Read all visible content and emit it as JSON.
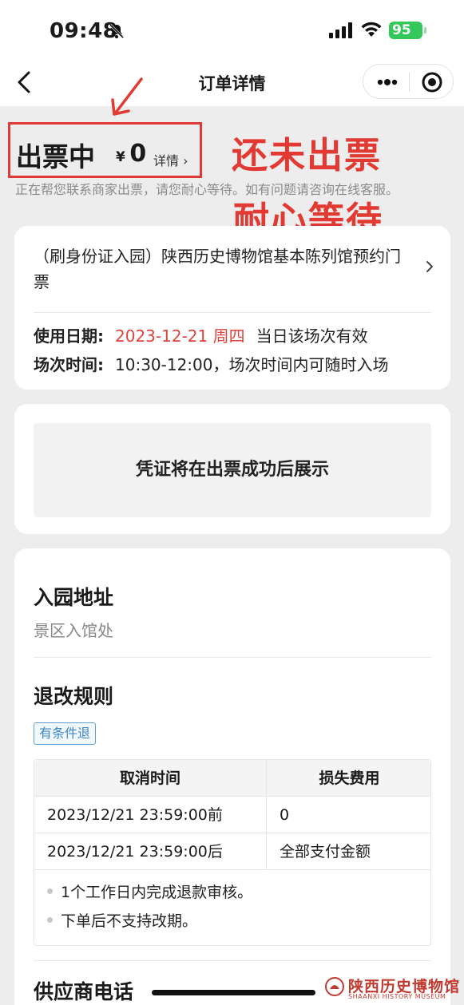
{
  "status_bar": {
    "time": "09:48",
    "battery": "95"
  },
  "nav": {
    "title": "订单详情"
  },
  "order_status": {
    "title": "出票中",
    "currency": "¥",
    "amount": "0",
    "detail_link": "详情 ›",
    "description": "正在帮您联系商家出票，请您耐心等待。如有问题请咨询在线客服。"
  },
  "annotations": {
    "line1": "还未出票",
    "line2": "耐心等待",
    "color": "#e23a32"
  },
  "product": {
    "name": "（刷身份证入园）陕西历史博物馆基本陈列馆预约门票",
    "use_date_label": "使用日期:",
    "use_date": "2023-12-21 周四",
    "use_date_note": "当日该场次有效",
    "session_label": "场次时间:",
    "session": "10:30-12:00，场次时间内可随时入场"
  },
  "voucher": {
    "text": "凭证将在出票成功后展示"
  },
  "entry": {
    "title": "入园地址",
    "value": "景区入馆处"
  },
  "refund": {
    "title": "退改规则",
    "tag": "有条件退",
    "headers": [
      "取消时间",
      "损失费用"
    ],
    "rows": [
      [
        "2023/12/21 23:59:00前",
        "0"
      ],
      [
        "2023/12/21 23:59:00后",
        "全部支付金额"
      ]
    ],
    "notes": [
      "1个工作日内完成退款审核。",
      "下单后不支持改期。"
    ]
  },
  "next_section": {
    "title": "供应商电话"
  },
  "watermark": {
    "cn": "陕西历史博物馆",
    "en": "SHAANXI HISTORY MUSEUM"
  }
}
